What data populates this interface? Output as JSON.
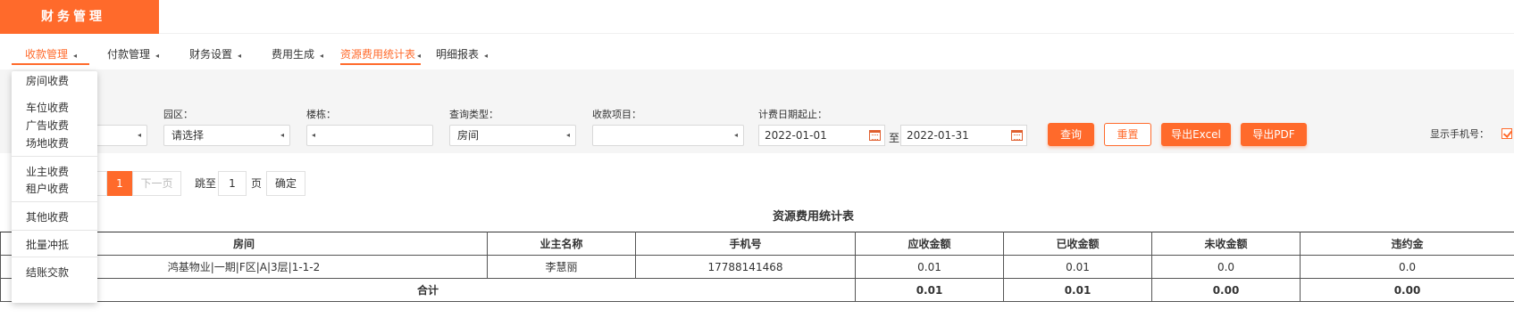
{
  "header": {
    "brand": "财务管理",
    "brand_color": "#ff6a2b"
  },
  "nav": {
    "tabs": [
      {
        "label": "收款管理",
        "active": true
      },
      {
        "label": "付款管理",
        "active": false
      },
      {
        "label": "财务设置",
        "active": false
      },
      {
        "label": "费用生成",
        "active": false
      },
      {
        "label": "资源费用统计表",
        "active": true
      },
      {
        "label": "明细报表",
        "active": false
      }
    ],
    "arrow_icon": "caret-left-icon"
  },
  "dropdown": {
    "items": [
      "房间收费",
      "车位收费",
      "广告收费",
      "场地收费",
      "业主收费",
      "租户收费",
      "其他收费",
      "批量冲抵",
      "结账交款"
    ]
  },
  "filters": {
    "park_label": "园区：",
    "park_value": "请选择",
    "building_label": "楼栋：",
    "query_type_label": "查询类型：",
    "query_type_value": "房间",
    "charge_item_label": "收款项目：",
    "date_label": "计费日期起止：",
    "date_from": "2022-01-01",
    "date_to_sep": "至",
    "date_to": "2022-01-31",
    "calendar_icon": "calendar-icon",
    "show_phone_label": "显示手机号：",
    "show_phone_checked": true
  },
  "buttons": {
    "query": "查询",
    "reset": "重置",
    "export_excel": "导出Excel",
    "export_pdf": "导出PDF"
  },
  "pager": {
    "prev": "页",
    "current": "1",
    "next": "下一页",
    "jump_to": "跳至",
    "page_input": "1",
    "page_unit": "页",
    "confirm": "确定"
  },
  "report": {
    "title": "资源费用统计表",
    "columns": [
      "房间",
      "业主名称",
      "手机号",
      "应收金额",
      "已收金额",
      "未收金额",
      "违约金"
    ],
    "rows": [
      [
        "鸿基物业|一期|F区|A|3层|1-1-2",
        "李慧丽",
        "17788141468",
        "0.01",
        "0.01",
        "0.0",
        "0.0"
      ]
    ],
    "total": {
      "label": "合计",
      "receivable": "0.01",
      "received": "0.01",
      "unreceived": "0.00",
      "penalty": "0.00"
    }
  }
}
